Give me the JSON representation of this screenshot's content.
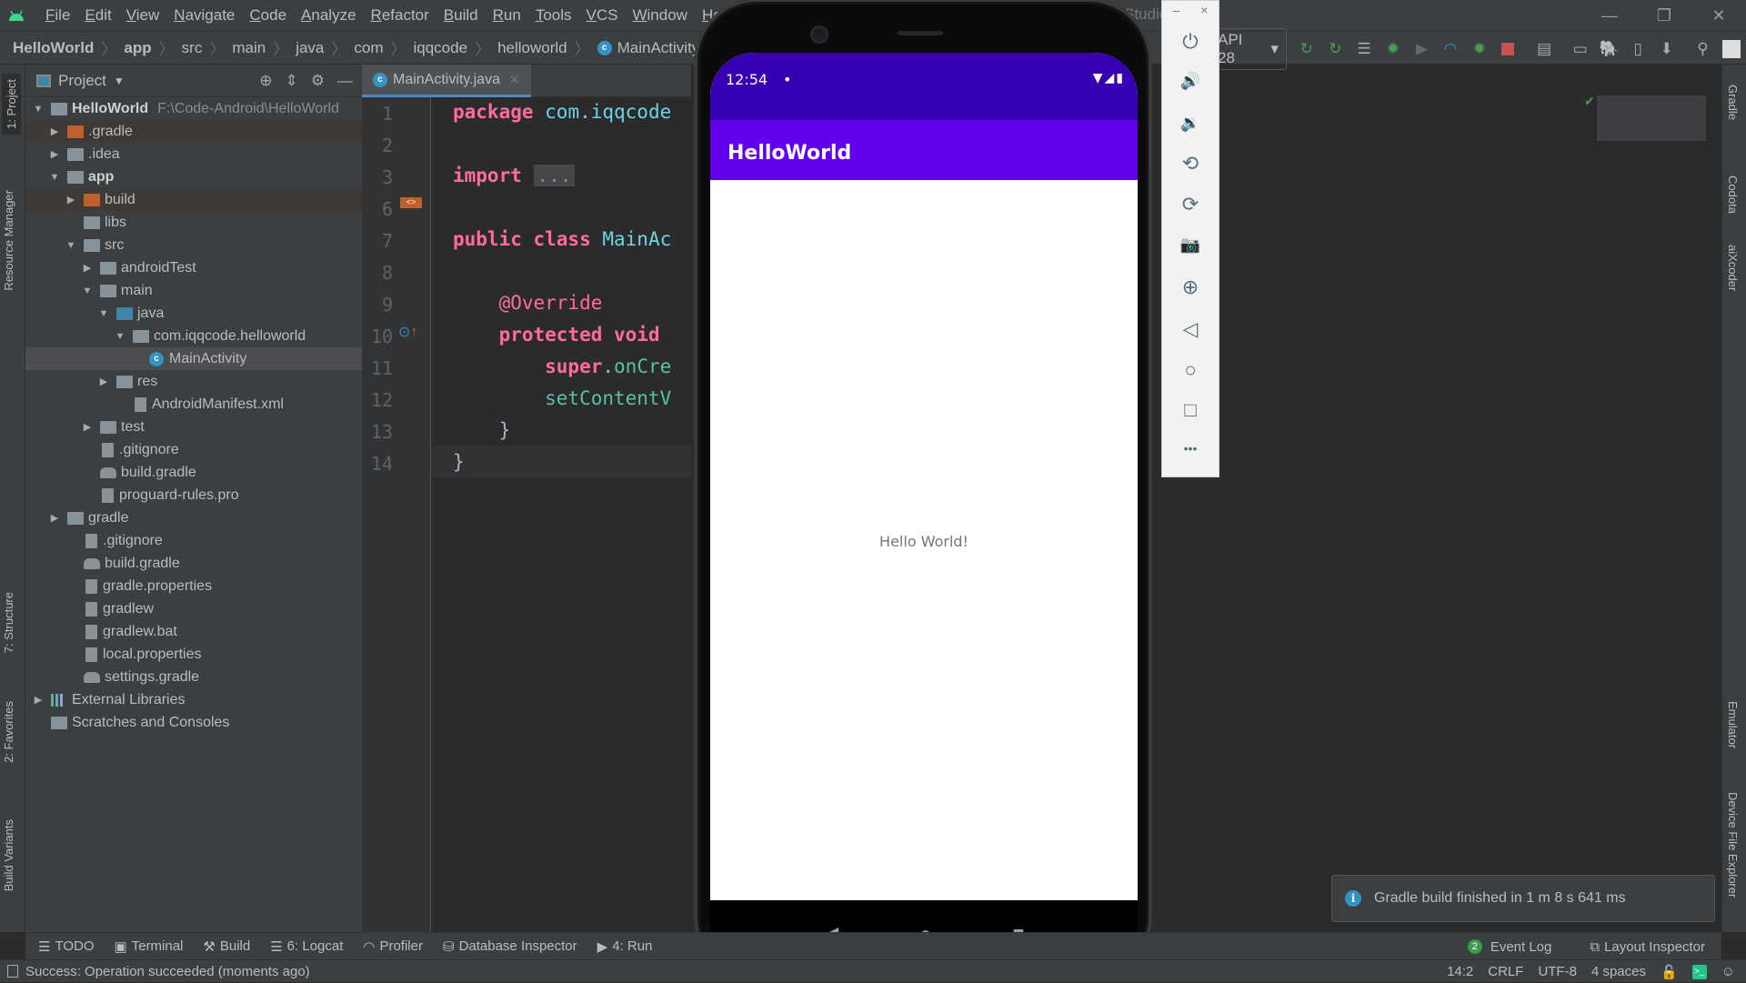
{
  "window": {
    "app_title_fragment": "Studio",
    "controls": {
      "minimize": "—",
      "maximize": "❐",
      "close": "✕"
    }
  },
  "menu": [
    "File",
    "Edit",
    "View",
    "Navigate",
    "Code",
    "Analyze",
    "Refactor",
    "Build",
    "Run",
    "Tools",
    "VCS",
    "Window",
    "Help"
  ],
  "breadcrumb": [
    "HelloWorld",
    "app",
    "src",
    "main",
    "java",
    "com",
    "iqqcode",
    "helloworld",
    "MainActivity"
  ],
  "toolbar": {
    "device_selector": "API 28",
    "icons": [
      "apply-changes-icon",
      "apply-code-changes-icon",
      "sync-icon",
      "debug-icon",
      "coverage-icon",
      "profile-icon",
      "attach-debugger-icon",
      "stop-icon",
      "project-structure-icon",
      "avd-manager-icon",
      "gradle-sync-icon",
      "device-manager-icon",
      "sdk-manager-icon",
      "search-icon",
      "account-icon"
    ]
  },
  "left_tabs": {
    "project": "1: Project",
    "resource_manager": "Resource Manager",
    "structure": "7: Structure",
    "favorites": "2: Favorites",
    "build_variants": "Build Variants"
  },
  "right_tabs": {
    "gradle": "Gradle",
    "codota": "Codota",
    "aixcoder": "aiXcoder",
    "emulator": "Emulator",
    "device_file_explorer": "Device File Explorer"
  },
  "project_panel": {
    "title": "Project",
    "tree": [
      {
        "label": "HelloWorld",
        "hint": "F:\\Code-Android\\HelloWorld",
        "depth": 0,
        "arrow": "down",
        "icon": "module",
        "bold": true
      },
      {
        "label": ".gradle",
        "depth": 1,
        "arrow": "right",
        "icon": "folder-orange"
      },
      {
        "label": ".idea",
        "depth": 1,
        "arrow": "right",
        "icon": "folder"
      },
      {
        "label": "app",
        "depth": 1,
        "arrow": "down",
        "icon": "module",
        "bold": true
      },
      {
        "label": "build",
        "depth": 2,
        "arrow": "right",
        "icon": "folder-orange"
      },
      {
        "label": "libs",
        "depth": 2,
        "arrow": "",
        "icon": "folder"
      },
      {
        "label": "src",
        "depth": 2,
        "arrow": "down",
        "icon": "folder"
      },
      {
        "label": "androidTest",
        "depth": 3,
        "arrow": "right",
        "icon": "folder"
      },
      {
        "label": "main",
        "depth": 3,
        "arrow": "down",
        "icon": "folder"
      },
      {
        "label": "java",
        "depth": 4,
        "arrow": "down",
        "icon": "folder-blue"
      },
      {
        "label": "com.iqqcode.helloworld",
        "depth": 5,
        "arrow": "down",
        "icon": "package"
      },
      {
        "label": "MainActivity",
        "depth": 6,
        "arrow": "",
        "icon": "class",
        "selected": true
      },
      {
        "label": "res",
        "depth": 4,
        "arrow": "right",
        "icon": "folder"
      },
      {
        "label": "AndroidManifest.xml",
        "depth": 5,
        "arrow": "",
        "icon": "manifest"
      },
      {
        "label": "test",
        "depth": 3,
        "arrow": "right",
        "icon": "folder"
      },
      {
        "label": ".gitignore",
        "depth": 3,
        "arrow": "",
        "icon": "file"
      },
      {
        "label": "build.gradle",
        "depth": 3,
        "arrow": "",
        "icon": "gradle"
      },
      {
        "label": "proguard-rules.pro",
        "depth": 3,
        "arrow": "",
        "icon": "file"
      },
      {
        "label": "gradle",
        "depth": 1,
        "arrow": "right",
        "icon": "folder"
      },
      {
        "label": ".gitignore",
        "depth": 2,
        "arrow": "",
        "icon": "file"
      },
      {
        "label": "build.gradle",
        "depth": 2,
        "arrow": "",
        "icon": "gradle"
      },
      {
        "label": "gradle.properties",
        "depth": 2,
        "arrow": "",
        "icon": "file"
      },
      {
        "label": "gradlew",
        "depth": 2,
        "arrow": "",
        "icon": "file"
      },
      {
        "label": "gradlew.bat",
        "depth": 2,
        "arrow": "",
        "icon": "file"
      },
      {
        "label": "local.properties",
        "depth": 2,
        "arrow": "",
        "icon": "file"
      },
      {
        "label": "settings.gradle",
        "depth": 2,
        "arrow": "",
        "icon": "gradle"
      },
      {
        "label": "External Libraries",
        "depth": 0,
        "arrow": "right",
        "icon": "libraries"
      },
      {
        "label": "Scratches and Consoles",
        "depth": 0,
        "arrow": "",
        "icon": "scratches"
      }
    ]
  },
  "editor": {
    "tab": "MainActivity.java",
    "lines": [
      {
        "n": "1",
        "tokens": [
          [
            "kw",
            "package "
          ],
          [
            "pk",
            "com.iqqcode"
          ]
        ]
      },
      {
        "n": "2",
        "tokens": []
      },
      {
        "n": "3",
        "tokens": [
          [
            "kw",
            "import "
          ],
          [
            "fold",
            "..."
          ]
        ]
      },
      {
        "n": "6",
        "tokens": []
      },
      {
        "n": "7",
        "tokens": [
          [
            "kw",
            "public class "
          ],
          [
            "pk",
            "MainAc"
          ]
        ]
      },
      {
        "n": "8",
        "tokens": []
      },
      {
        "n": "9",
        "tokens": [
          [
            "an",
            "    @Override"
          ]
        ]
      },
      {
        "n": "10",
        "tokens": [
          [
            "kw",
            "    protected void "
          ]
        ]
      },
      {
        "n": "11",
        "tokens": [
          [
            "kw",
            "        super"
          ],
          [
            "",
            "."
          ],
          [
            "fn",
            "onCre"
          ]
        ]
      },
      {
        "n": "12",
        "tokens": [
          [
            "fn",
            "        setContentV"
          ]
        ]
      },
      {
        "n": "13",
        "tokens": [
          [
            "",
            "    }"
          ]
        ]
      },
      {
        "n": "14",
        "tokens": [
          [
            "",
            "}"
          ]
        ]
      }
    ]
  },
  "phone": {
    "time": "12:54",
    "dot": "•",
    "status_icons": "▼◢▮",
    "app_title": "HelloWorld",
    "content_text": "Hello World!",
    "nav": {
      "back": "◀",
      "home": "●",
      "recents": "■"
    },
    "colors": {
      "status_bar": "#3700b3",
      "app_bar": "#6200ee"
    }
  },
  "emulator_toolbar": {
    "top": {
      "minimize": "–",
      "close": "×"
    },
    "buttons": [
      {
        "name": "power-icon",
        "glyph": "⏻"
      },
      {
        "name": "volume-up-icon",
        "glyph": "🔊"
      },
      {
        "name": "volume-down-icon",
        "glyph": "🔉"
      },
      {
        "name": "rotate-left-icon",
        "glyph": "⟲"
      },
      {
        "name": "rotate-right-icon",
        "glyph": "⟳"
      },
      {
        "name": "screenshot-icon",
        "glyph": "📷"
      },
      {
        "name": "zoom-icon",
        "glyph": "⊕"
      },
      {
        "name": "back-icon",
        "glyph": "◁"
      },
      {
        "name": "home-icon",
        "glyph": "○"
      },
      {
        "name": "overview-icon",
        "glyph": "□"
      },
      {
        "name": "more-icon",
        "glyph": "•••"
      }
    ]
  },
  "notification": {
    "text": "Gradle build finished in 1 m 8 s 641 ms"
  },
  "tool_windows": {
    "left": [
      {
        "name": "todo",
        "label": "TODO",
        "icon": "☰"
      },
      {
        "name": "terminal",
        "label": "Terminal",
        "icon": "▣"
      },
      {
        "name": "build",
        "label": "Build",
        "icon": "⚒"
      },
      {
        "name": "logcat",
        "label": "6: Logcat",
        "icon": "☰"
      },
      {
        "name": "profiler",
        "label": "Profiler",
        "icon": "◠"
      },
      {
        "name": "database-inspector",
        "label": "Database Inspector",
        "icon": "⛁"
      },
      {
        "name": "run",
        "label": "4: Run",
        "icon": "▶"
      }
    ],
    "right": [
      {
        "name": "event-log",
        "label": "Event Log",
        "badge": "2"
      },
      {
        "name": "layout-inspector",
        "label": "Layout Inspector",
        "icon": "⧉"
      }
    ]
  },
  "status_bar": {
    "message": "Success: Operation succeeded (moments ago)",
    "position": "14:2",
    "line_separator": "CRLF",
    "encoding": "UTF-8",
    "indent": "4 spaces"
  }
}
